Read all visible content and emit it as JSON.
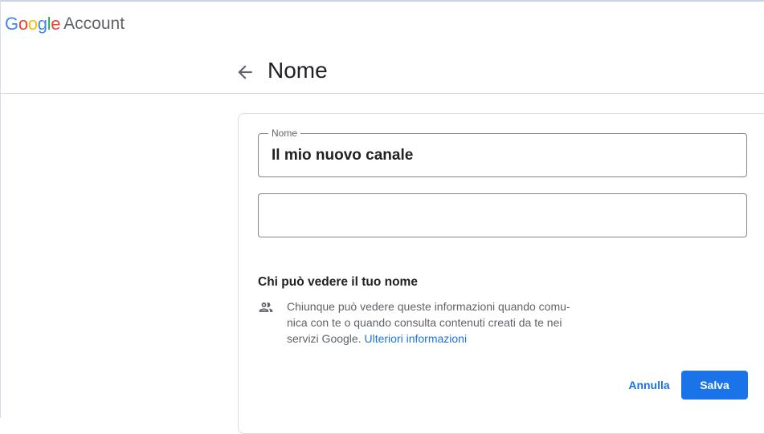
{
  "header": {
    "logo_letters": [
      "G",
      "o",
      "o",
      "g",
      "l",
      "e"
    ],
    "logo_colors": [
      "#4285F4",
      "#EA4335",
      "#FBBC05",
      "#4285F4",
      "#34A853",
      "#EA4335"
    ],
    "product": "Account"
  },
  "page": {
    "back_icon": "arrow-back-icon",
    "title": "Nome"
  },
  "form": {
    "first_name": {
      "label": "Nome",
      "value": "Il mio nuovo canale"
    },
    "last_name": {
      "label": "",
      "value": ""
    }
  },
  "visibility": {
    "title": "Chi può vedere il tuo nome",
    "icon": "people-icon",
    "text": "Chiunque può vedere queste informazioni quando comunica con te o quando consulta contenuti creati da te nei servizi Google.",
    "text_line1": "Chiunque può vedere queste informazioni quando comu-",
    "text_line2": "nica con te o quando consulta contenuti creati da te nei",
    "text_line3": "servizi Google.",
    "link": "Ulteriori informazioni"
  },
  "actions": {
    "cancel_label": "Annulla",
    "save_label": "Salva"
  },
  "colors": {
    "accent": "#1a73e8",
    "border": "#dadce0",
    "text_secondary": "#5f6368"
  }
}
